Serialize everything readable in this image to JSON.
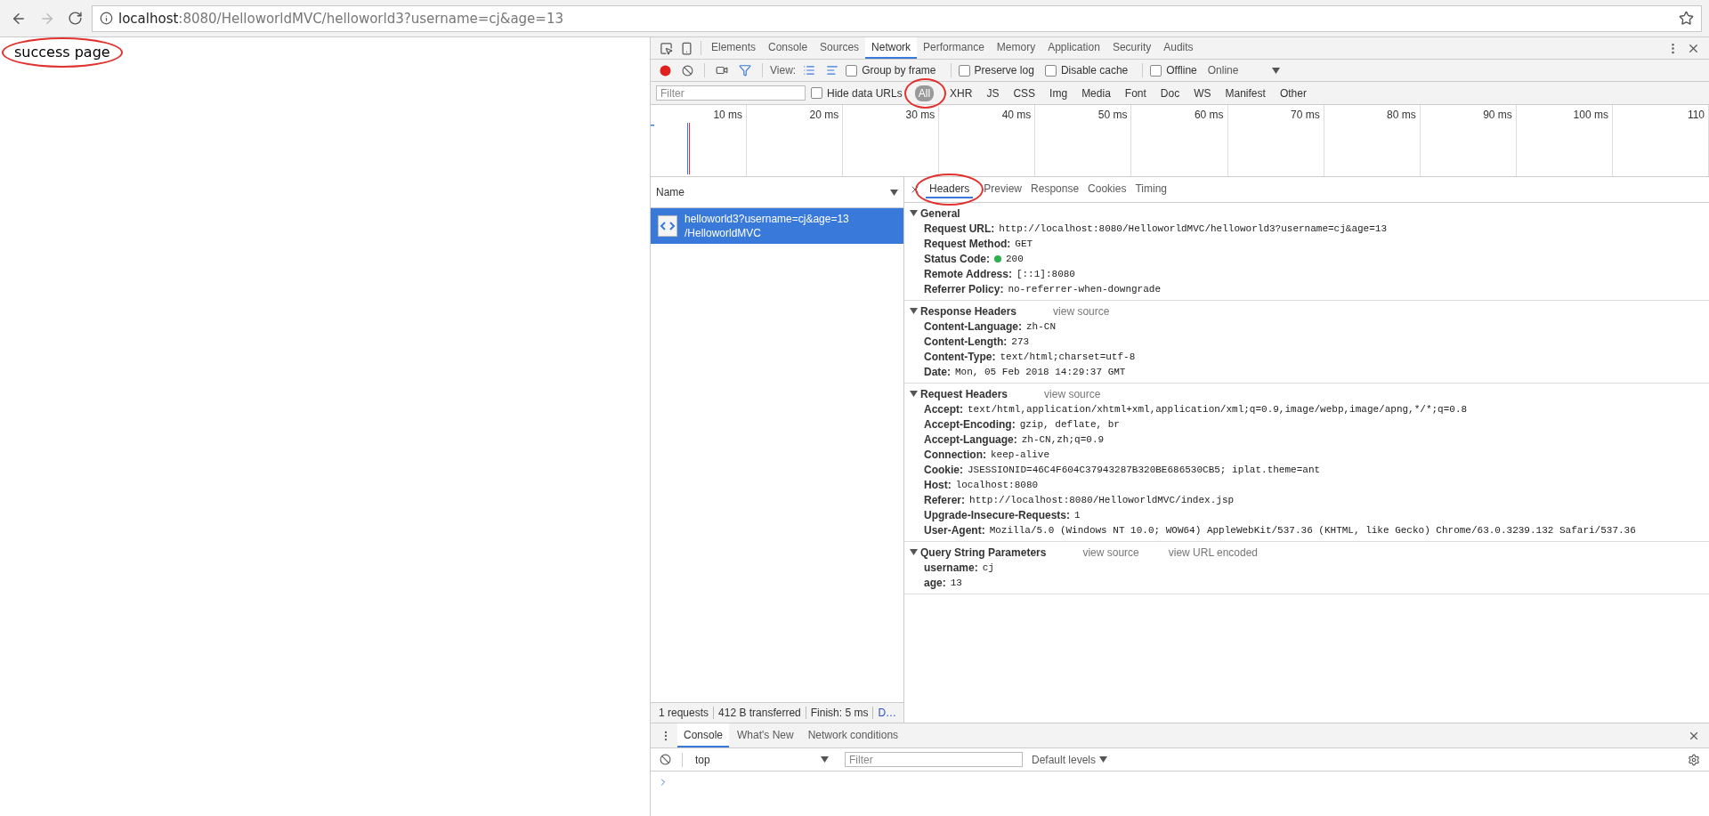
{
  "browser": {
    "back_disabled": false,
    "forward_disabled": true,
    "address": {
      "host": "localhost",
      "rest": ":8080/HelloworldMVC/helloworld3?username=cj&age=13"
    }
  },
  "page": {
    "text": "success page",
    "circled": true
  },
  "devtools": {
    "tabs": [
      {
        "label": "Elements",
        "selected": false
      },
      {
        "label": "Console",
        "selected": false
      },
      {
        "label": "Sources",
        "selected": false
      },
      {
        "label": "Network",
        "selected": true
      },
      {
        "label": "Performance",
        "selected": false
      },
      {
        "label": "Memory",
        "selected": false
      },
      {
        "label": "Application",
        "selected": false
      },
      {
        "label": "Security",
        "selected": false
      },
      {
        "label": "Audits",
        "selected": false
      }
    ],
    "toolbar": {
      "recording": true,
      "view_label": "View:",
      "large_rows": true,
      "group_checkbox": {
        "label": "Group by frame",
        "checked": false
      },
      "options": [
        {
          "label": "Preserve log",
          "checked": false
        },
        {
          "label": "Disable cache",
          "checked": false
        }
      ],
      "offline": {
        "label": "Offline",
        "checked": false
      },
      "throttle": "Online"
    },
    "filter": {
      "placeholder": "Filter",
      "hide_data_urls": {
        "label": "Hide data URLs",
        "checked": false
      },
      "types": [
        {
          "label": "All",
          "selected": true,
          "circled": true
        },
        {
          "label": "XHR",
          "selected": false,
          "circled": false
        },
        {
          "label": "JS",
          "selected": false,
          "circled": false
        },
        {
          "label": "CSS",
          "selected": false,
          "circled": false
        },
        {
          "label": "Img",
          "selected": false,
          "circled": false
        },
        {
          "label": "Media",
          "selected": false,
          "circled": false
        },
        {
          "label": "Font",
          "selected": false,
          "circled": false
        },
        {
          "label": "Doc",
          "selected": false,
          "circled": false
        },
        {
          "label": "WS",
          "selected": false,
          "circled": false
        },
        {
          "label": "Manifest",
          "selected": false,
          "circled": false
        },
        {
          "label": "Other",
          "selected": false,
          "circled": false
        }
      ]
    },
    "timeline": {
      "ticks": [
        "10 ms",
        "20 ms",
        "30 ms",
        "40 ms",
        "50 ms",
        "60 ms",
        "70 ms",
        "80 ms",
        "90 ms",
        "100 ms",
        "110"
      ]
    },
    "requests": {
      "column": "Name",
      "rows": [
        {
          "name": "helloworld3?username=cj&age=13",
          "path": "/HelloworldMVC",
          "selected": true
        }
      ]
    },
    "details": {
      "tabs": [
        {
          "label": "Headers",
          "selected": true,
          "circled": true
        },
        {
          "label": "Preview",
          "selected": false,
          "circled": false
        },
        {
          "label": "Response",
          "selected": false,
          "circled": false
        },
        {
          "label": "Cookies",
          "selected": false,
          "circled": false
        },
        {
          "label": "Timing",
          "selected": false,
          "circled": false
        }
      ],
      "sections": [
        {
          "title": "General",
          "expanded": true,
          "rows": [
            {
              "key": "Request URL:",
              "value": "http://localhost:8080/HelloworldMVC/helloworld3?username=cj&age=13"
            },
            {
              "key": "Request Method:",
              "value": "GET"
            },
            {
              "key": "Status Code:",
              "value": "200",
              "color": "#2bb24c"
            },
            {
              "key": "Remote Address:",
              "value": "[::1]:8080"
            },
            {
              "key": "Referrer Policy:",
              "value": "no-referrer-when-downgrade"
            }
          ]
        },
        {
          "title": "Response Headers",
          "expanded": true,
          "links": [
            "view source"
          ],
          "rows": [
            {
              "key": "Content-Language:",
              "value": "zh-CN"
            },
            {
              "key": "Content-Length:",
              "value": "273"
            },
            {
              "key": "Content-Type:",
              "value": "text/html;charset=utf-8"
            },
            {
              "key": "Date:",
              "value": "Mon, 05 Feb 2018 14:29:37 GMT"
            }
          ]
        },
        {
          "title": "Request Headers",
          "expanded": true,
          "links": [
            "view source"
          ],
          "rows": [
            {
              "key": "Accept:",
              "value": "text/html,application/xhtml+xml,application/xml;q=0.9,image/webp,image/apng,*/*;q=0.8"
            },
            {
              "key": "Accept-Encoding:",
              "value": "gzip, deflate, br"
            },
            {
              "key": "Accept-Language:",
              "value": "zh-CN,zh;q=0.9"
            },
            {
              "key": "Connection:",
              "value": "keep-alive"
            },
            {
              "key": "Cookie:",
              "value": "JSESSIONID=46C4F604C37943287B320BE686530CB5; iplat.theme=ant"
            },
            {
              "key": "Host:",
              "value": "localhost:8080"
            },
            {
              "key": "Referer:",
              "value": "http://localhost:8080/HelloworldMVC/index.jsp"
            },
            {
              "key": "Upgrade-Insecure-Requests:",
              "value": "1"
            },
            {
              "key": "User-Agent:",
              "value": "Mozilla/5.0 (Windows NT 10.0; WOW64) AppleWebKit/537.36 (KHTML, like Gecko) Chrome/63.0.3239.132 Safari/537.36"
            }
          ]
        },
        {
          "title": "Query String Parameters",
          "expanded": true,
          "links": [
            "view source",
            "view URL encoded"
          ],
          "rows": [
            {
              "key": "username:",
              "value": "cj"
            },
            {
              "key": "age:",
              "value": "13"
            }
          ]
        }
      ]
    },
    "status_bar": [
      {
        "text": "1 requests",
        "kind": "text"
      },
      {
        "text": "412 B transferred",
        "kind": "text"
      },
      {
        "text": "Finish: 5 ms",
        "kind": "text"
      },
      {
        "text": "D…",
        "kind": "link"
      }
    ],
    "drawer": {
      "tabs": [
        {
          "label": "Console",
          "selected": true
        },
        {
          "label": "What's New",
          "selected": false
        },
        {
          "label": "Network conditions",
          "selected": false
        }
      ],
      "context": "top",
      "filter_placeholder": "Filter",
      "levels": "Default levels"
    }
  }
}
